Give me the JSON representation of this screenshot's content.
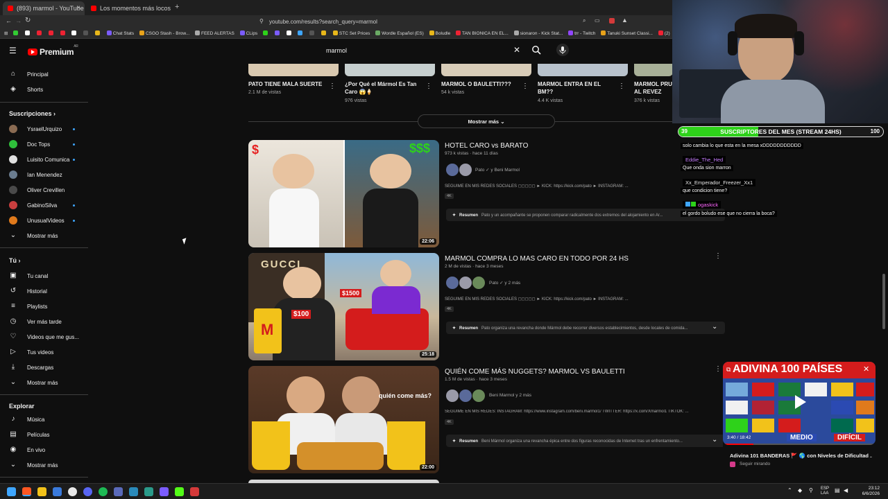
{
  "browser": {
    "tabs": [
      {
        "title": "(893) marmol - YouTube",
        "active": true
      },
      {
        "title": "Los momentos más locos del fútbol !",
        "active": false
      }
    ],
    "url": "youtube.com/results?search_query=marmol",
    "bookmarks": [
      "Chat Stats",
      "CSGO Stash - Brow...",
      "FEED ALERTAS",
      "CLips",
      "STC Set Prices",
      "Wordle Español (ES)",
      "Boludle",
      "TAN BIONICA EN EL...",
      "sionaron - Kick Stat...",
      "trr - Twitch",
      "Tanuki Sunset Classi...",
      "(2)"
    ]
  },
  "header": {
    "logo": "Premium",
    "logo_sup": "AR",
    "search_value": "marmol"
  },
  "sidebar": {
    "main": [
      {
        "label": "Principal",
        "icon": "home-icon"
      },
      {
        "label": "Shorts",
        "icon": "shorts-icon"
      }
    ],
    "subs_heading": "Suscripciones",
    "subs": [
      {
        "label": "YsraelUrquizo",
        "color": "#8a6b52",
        "dot": true
      },
      {
        "label": "Doc Tops",
        "color": "#2fbf3b",
        "dot": true
      },
      {
        "label": "Luisito Comunica",
        "color": "#e0e0e0",
        "dot": true
      },
      {
        "label": "Ian Menendez",
        "color": "#6a7c8f",
        "dot": false
      },
      {
        "label": "Oliver Crevillen",
        "color": "#4a4a4a",
        "dot": false
      },
      {
        "label": "GabinoSilva",
        "color": "#c93f3f",
        "dot": true
      },
      {
        "label": "UnusualVideos",
        "color": "#e07a1c",
        "dot": true
      }
    ],
    "subs_more": "Mostrar más",
    "you_heading": "Tú",
    "you": [
      {
        "label": "Tu canal",
        "icon": "channel-icon"
      },
      {
        "label": "Historial",
        "icon": "history-icon"
      },
      {
        "label": "Playlists",
        "icon": "playlists-icon"
      },
      {
        "label": "Ver más tarde",
        "icon": "watch-later-icon"
      },
      {
        "label": "Videos que me gus...",
        "icon": "liked-icon"
      },
      {
        "label": "Tus videos",
        "icon": "your-videos-icon"
      },
      {
        "label": "Descargas",
        "icon": "downloads-icon"
      }
    ],
    "you_more": "Mostrar más",
    "explore_heading": "Explorar",
    "explore": [
      {
        "label": "Música",
        "icon": "music-icon"
      },
      {
        "label": "Películas",
        "icon": "movies-icon"
      },
      {
        "label": "En vivo",
        "icon": "live-icon"
      }
    ],
    "explore_more": "Mostrar más"
  },
  "shorts": [
    {
      "title": "PATO TIENE MALA SUERTE",
      "views": "2.1 M de vistas"
    },
    {
      "title": "¿Por Qué el Mármol Es Tan Caro 😱🍦",
      "views": "976 vistas"
    },
    {
      "title": "MARMOL O BAULETTI???",
      "views": "54 k vistas"
    },
    {
      "title": "MARMOL ENTRA EN EL BM??",
      "views": "4.4 K vistas"
    },
    {
      "title": "MARMOL PRU AL REVEZ",
      "views": "376 k vistas"
    }
  ],
  "show_more": "Mostrar más",
  "videos": [
    {
      "title": "HOTEL CARO vs BARATO",
      "meta": "973 k vistas · hace 11 días",
      "channel": "Pato ✓ y Beni Marmol",
      "desc": "SEGUIME EN MIS REDES SOCIALES ◻◻◻◻◻ ► KICK: https://kick.com/pato ► INSTAGRAM: ...",
      "badge": "4K",
      "summary_label": "Resumen",
      "summary": "Pato y un acompañante se proponen comparar radicalmente dos extremos del alojamiento en Ar...",
      "duration": "22:06"
    },
    {
      "title": "MARMOL COMPRA LO MAS CARO EN TODO POR 24 HS",
      "meta": "2 M de vistas · hace 3 meses",
      "channel": "Pato ✓ y 2 más",
      "desc": "SEGUIME EN MIS REDES SOCIALES ◻◻◻◻◻ ► KICK: https://kick.com/pato ► INSTAGRAM: ...",
      "badge": "4K",
      "summary_label": "Resumen",
      "summary": "Pato organiza una revancha donde Mármol debe recorrer diversos establecimientos, desde locales de comida...",
      "duration": "25:18"
    },
    {
      "title": "QUIÉN COME MÁS NUGGETS? MARMOL VS BAULETTI",
      "meta": "1.5 M de vistas · hace 3 meses",
      "channel": "Beni Marmol y 2 más",
      "desc": "SEGUIME EN MIS REDES: INSTAGRAM: https://www.instagram.com/beni.marmol1/ TWITTER: https://x.com/Xmarmol1 TIKTOK: ...",
      "badge": "4K",
      "summary_label": "Resumen",
      "summary": "Beni Mármol organiza una revancha épica entre dos figuras reconocidas de Internet tras un enfrentamiento...",
      "duration": "22:00"
    }
  ],
  "thumb_text": {
    "v1_price": "$$$",
    "v1_cheap": "$",
    "v2_brand": "GUCCI",
    "v2_price1": "$1500",
    "v2_price2": "$100",
    "v3_caption": "quién come más?"
  },
  "overlay": {
    "subs_current": "39",
    "subs_label": "SUSCRIPTORES DEL MES (STREAM 24HS)",
    "subs_goal": "100",
    "subs_progress": 0.39,
    "chat": [
      {
        "type": "msg",
        "text": "solo cambia lo que esta en la mesa xDDDDDDDDDDD"
      },
      {
        "type": "user",
        "text": "Eddie_The_Hed",
        "color": "#c77dff"
      },
      {
        "type": "msg",
        "text": "Que onda sion marron"
      },
      {
        "type": "user",
        "text": "Xx_Emperador_Freezer_Xx1",
        "color": "#e8e8e8"
      },
      {
        "type": "msg",
        "text": "que condicion tiene?"
      },
      {
        "type": "user",
        "text": "ogaskick",
        "color": "#ff66ff"
      },
      {
        "type": "msg",
        "text": "el gordo boludo ese que no cierra la boca?"
      }
    ]
  },
  "ad": {
    "banner": "ADIVINA 100 PAÍSES",
    "level1": "MEDIO",
    "level2": "DIFÍCIL",
    "time": "3:40 / 18:42",
    "title": "Adivina 101 BANDERAS 🚩 🌎 con Niveles de Dificultad ...",
    "sub": "Seguir mirando"
  },
  "taskbar": {
    "lang": "ESP",
    "lang2": "LAA",
    "time": "23:12",
    "date": "6/6/2026"
  },
  "colors": {
    "accent": "#ff0000",
    "subs_green": "#2ed21a",
    "link_blue": "#3ea6ff"
  }
}
